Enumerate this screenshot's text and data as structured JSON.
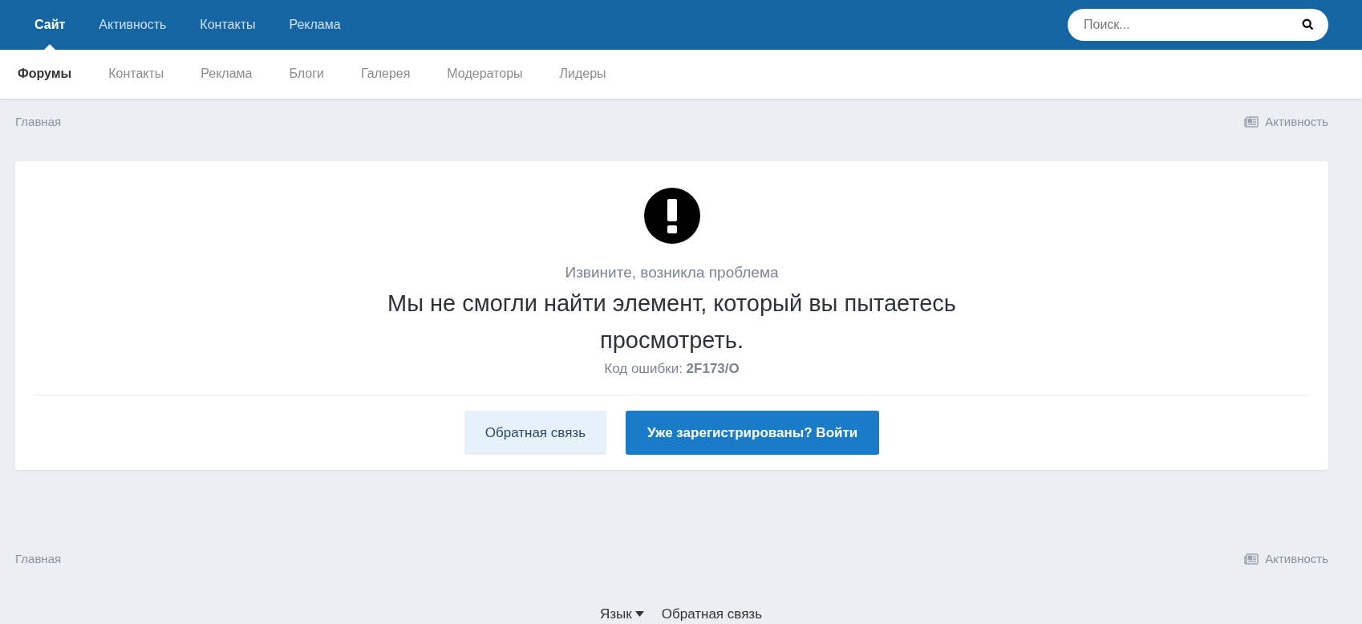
{
  "top_nav": [
    {
      "label": "Сайт",
      "selected": true
    },
    {
      "label": "Активность",
      "selected": false
    },
    {
      "label": "Контакты",
      "selected": false
    },
    {
      "label": "Реклама",
      "selected": false
    }
  ],
  "search": {
    "placeholder": "Поиск..."
  },
  "sub_nav": [
    {
      "label": "Форумы",
      "selected": true
    },
    {
      "label": "Контакты",
      "selected": false
    },
    {
      "label": "Реклама",
      "selected": false
    },
    {
      "label": "Блоги",
      "selected": false
    },
    {
      "label": "Галерея",
      "selected": false
    },
    {
      "label": "Модераторы",
      "selected": false
    },
    {
      "label": "Лидеры",
      "selected": false
    }
  ],
  "breadcrumb_top": {
    "home": "Главная",
    "activity": "Активность"
  },
  "error": {
    "subtitle": "Извините, возникла проблема",
    "message": "Мы не смогли найти элемент, который вы пытаетесь просмотреть.",
    "code": "Код ошибки: **2F173/O**"
  },
  "buttons": [
    {
      "label": "Обратная связь",
      "kind": "secondary"
    },
    {
      "label": "Уже зарегистрированы? Войти",
      "kind": "primary"
    }
  ],
  "breadcrumb_bottom": {
    "home": "Главная",
    "activity": "Активность"
  },
  "footer": {
    "language": "Язык",
    "feedback": "Обратная связь"
  }
}
